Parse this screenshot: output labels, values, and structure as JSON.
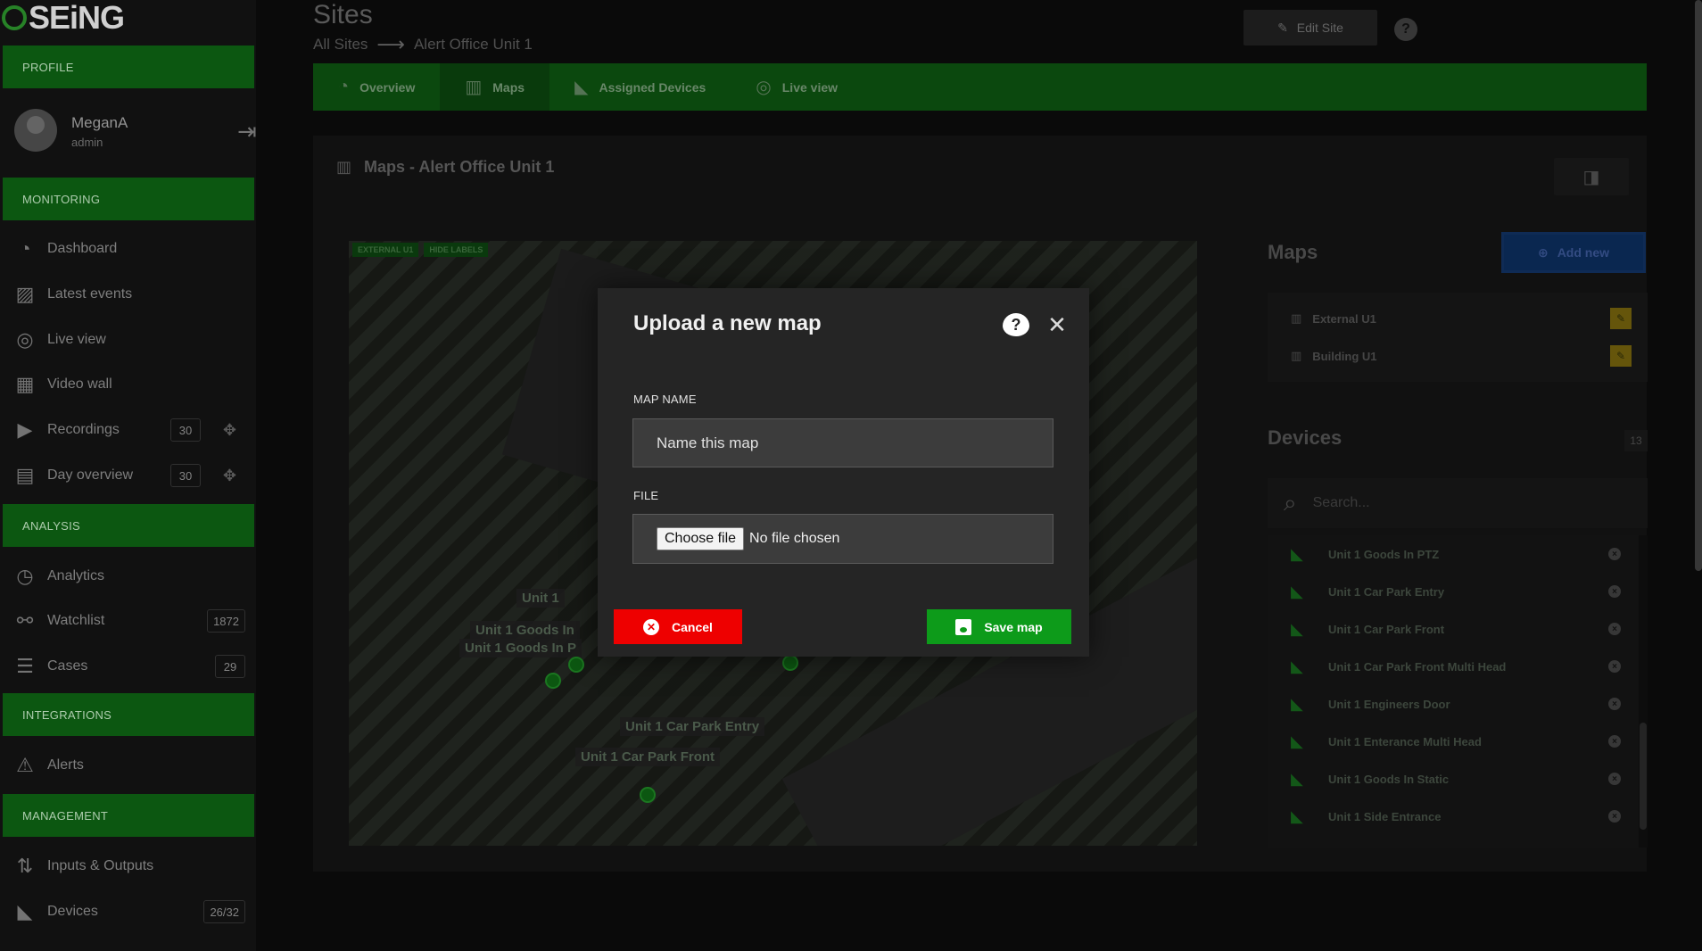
{
  "app": {
    "logo": "SEiNG"
  },
  "sidebar": {
    "sections": {
      "profile": "PROFILE",
      "monitoring": "MONITORING",
      "analysis": "ANALYSIS",
      "integrations": "INTEGRATIONS",
      "management": "MANAGEMENT"
    },
    "user": {
      "name": "MeganA",
      "role": "admin"
    },
    "monitoring_items": [
      {
        "label": "Dashboard",
        "icon": "dashboard-icon"
      },
      {
        "label": "Latest events",
        "icon": "image-icon"
      },
      {
        "label": "Live view",
        "icon": "live-icon"
      },
      {
        "label": "Video wall",
        "icon": "grid-icon"
      },
      {
        "label": "Recordings",
        "icon": "clapper-icon",
        "badge": "30"
      },
      {
        "label": "Day overview",
        "icon": "calendar-icon",
        "badge": "30"
      }
    ],
    "analysis_items": [
      {
        "label": "Analytics",
        "icon": "analytics-icon"
      },
      {
        "label": "Watchlist",
        "icon": "glasses-icon",
        "badge": "1872"
      },
      {
        "label": "Cases",
        "icon": "checklist-icon",
        "badge": "29"
      }
    ],
    "integrations_items": [
      {
        "label": "Alerts",
        "icon": "warning-icon"
      }
    ],
    "management_items": [
      {
        "label": "Inputs & Outputs",
        "icon": "io-icon"
      },
      {
        "label": "Devices",
        "icon": "camera-icon",
        "badge": "26/32"
      }
    ]
  },
  "header": {
    "title": "Sites",
    "breadcrumb_root": "All Sites",
    "breadcrumb_current": "Alert Office Unit 1",
    "edit_label": "Edit Site"
  },
  "tabs": [
    {
      "label": "Overview",
      "icon": "dashboard-icon"
    },
    {
      "label": "Maps",
      "icon": "map-icon"
    },
    {
      "label": "Assigned Devices",
      "icon": "camera-icon"
    },
    {
      "label": "Live view",
      "icon": "live-icon"
    }
  ],
  "panel": {
    "title": "Maps - Alert Office Unit 1",
    "map_tags": [
      "EXTERNAL U1",
      "HIDE LABELS"
    ],
    "map_labels": [
      "Unit 1 Goods In",
      "Unit 1 Goods In P",
      "Unit 1",
      "Unit 1 Car Park Entry",
      "Unit 1 Car Park Front"
    ],
    "maps_title": "Maps",
    "add_new_label": "Add new",
    "maps": [
      "External U1",
      "Building U1"
    ],
    "devices_title": "Devices",
    "devices_count": "13",
    "search_placeholder": "Search...",
    "devices": [
      "Unit 1 Goods In PTZ",
      "Unit 1 Car Park Entry",
      "Unit 1 Car Park Front",
      "Unit 1 Car Park Front Multi Head",
      "Unit 1 Engineers Door",
      "Unit 1 Enterance Multi Head",
      "Unit 1 Goods In Static",
      "Unit 1 Side Entrance"
    ]
  },
  "modal": {
    "title": "Upload a new map",
    "map_name_label": "MAP NAME",
    "map_name_placeholder": "Name this map",
    "file_label": "FILE",
    "choose_file_label": "Choose file",
    "file_status": "No file chosen",
    "cancel_label": "Cancel",
    "save_label": "Save map"
  },
  "colors": {
    "sidebar_section": "#0d5c12",
    "cancel": "#ee0000",
    "save": "#0d9b1a"
  }
}
